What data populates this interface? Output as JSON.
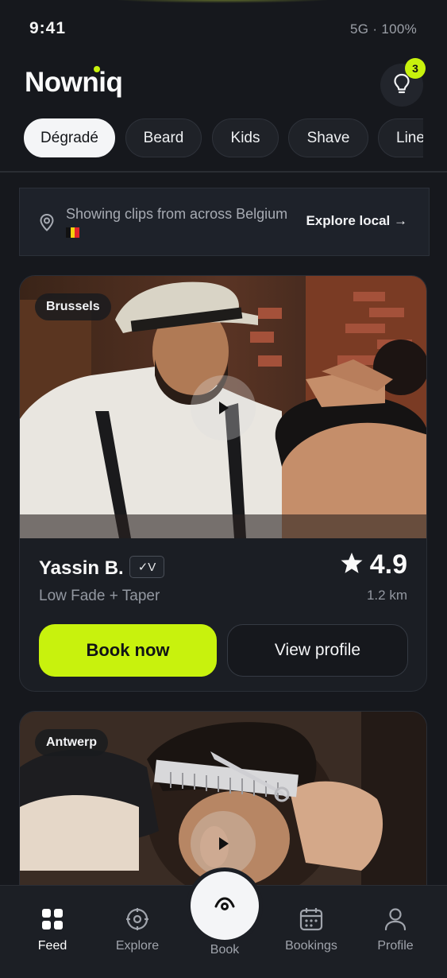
{
  "status_bar": {
    "time": "9:41",
    "network": "5G · 100%"
  },
  "header": {
    "app_name": "Nowniq",
    "notification_count": "3",
    "notification_icon": "bulb-icon"
  },
  "categories": [
    {
      "label": "Dégradé",
      "active": true
    },
    {
      "label": "Beard",
      "active": false
    },
    {
      "label": "Kids",
      "active": false
    },
    {
      "label": "Shave",
      "active": false
    },
    {
      "label": "Line",
      "active": false
    }
  ],
  "location_banner": {
    "icon": "location-pin-icon",
    "text": "Showing clips from across Belgium",
    "flag": "belgium-flag",
    "link_label": "Explore local →"
  },
  "feed": [
    {
      "city": "Brussels",
      "barber": "Yassin B.",
      "verified_label": "✓V",
      "service": "Low Fade + Taper",
      "rating": "4.9",
      "distance": "1.2 km",
      "book_label": "Book now",
      "profile_label": "View profile"
    },
    {
      "city": "Antwerp"
    }
  ],
  "nav": {
    "items": [
      {
        "label": "Feed",
        "icon": "grid-icon",
        "active": true
      },
      {
        "label": "Explore",
        "icon": "compass-icon",
        "active": false
      },
      {
        "label": "Book",
        "icon": "eye-icon",
        "active": false
      },
      {
        "label": "Bookings",
        "icon": "calendar-icon",
        "active": false
      },
      {
        "label": "Profile",
        "icon": "user-icon",
        "active": false
      }
    ]
  },
  "colors": {
    "accent": "#c8f20d",
    "background": "#16181d",
    "card": "#1b1e24",
    "muted_text": "#9398a1"
  }
}
